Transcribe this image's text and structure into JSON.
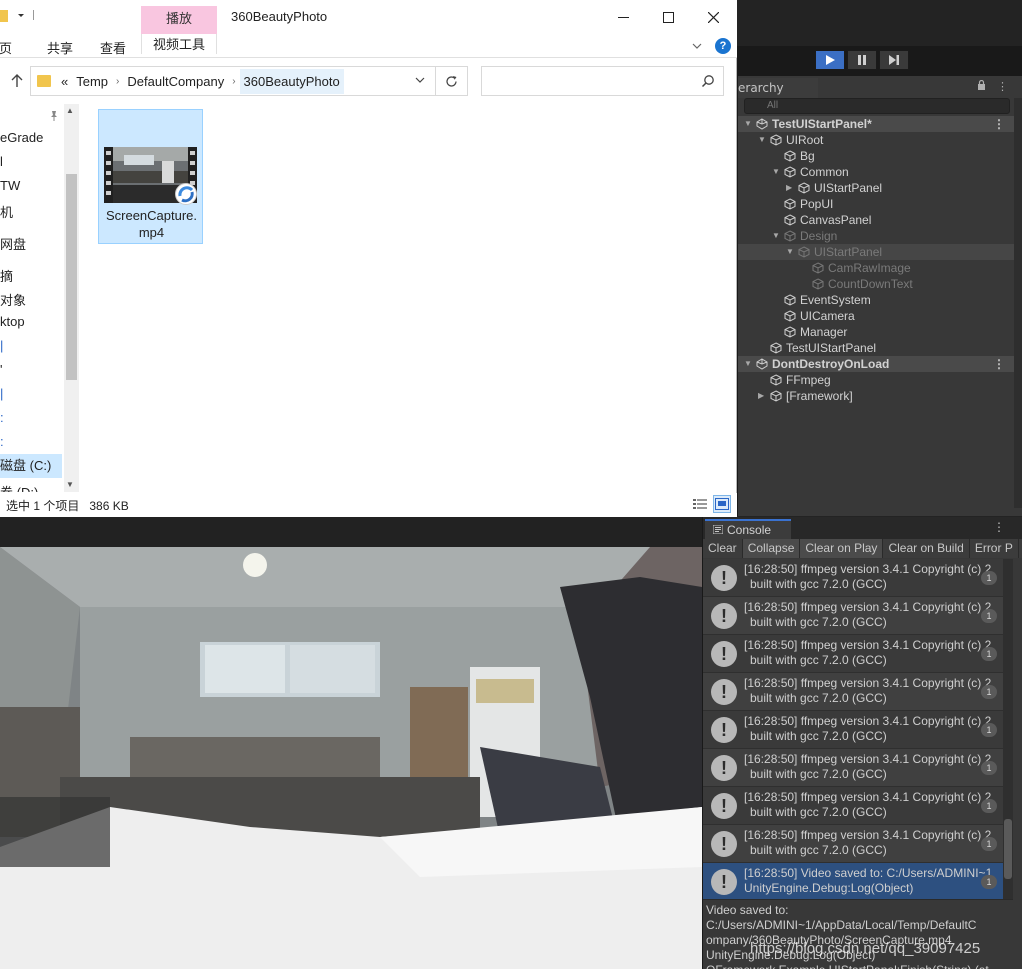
{
  "explorer": {
    "window_title": "360BeautyPhoto",
    "context_tab": "播放",
    "ribbon_tabs": {
      "home_partial": "主页",
      "share": "共享",
      "view": "查看",
      "video_tools": "视频工具"
    },
    "breadcrumb": {
      "overflow": "«",
      "items": [
        "Temp",
        "DefaultCompany",
        "360BeautyPhoto"
      ]
    },
    "search_placeholder": "",
    "nav_items": [
      "eGrade",
      "l",
      "TW",
      "机",
      "网盘",
      "摘",
      "对象",
      "ktop",
      "磁盘 (C:)",
      "卷 (D:)"
    ],
    "file": {
      "name": "ScreenCapture.mp4",
      "name_line1": "ScreenCapture.",
      "name_line2": "mp4"
    },
    "status": {
      "selected": "选中 1 个项目",
      "size": "386 KB"
    }
  },
  "unity": {
    "hierarchy": {
      "tab_label": "erarchy",
      "search_placeholder": "All",
      "rows": [
        {
          "label": "TestUIStartPanel*",
          "depth": 0,
          "arrow": "down",
          "kind": "scene",
          "menu": true
        },
        {
          "label": "UIRoot",
          "depth": 1,
          "arrow": "down",
          "kind": "obj"
        },
        {
          "label": "Bg",
          "depth": 2,
          "arrow": "",
          "kind": "obj"
        },
        {
          "label": "Common",
          "depth": 2,
          "arrow": "down",
          "kind": "obj"
        },
        {
          "label": "UIStartPanel",
          "depth": 3,
          "arrow": "right",
          "kind": "obj"
        },
        {
          "label": "PopUI",
          "depth": 2,
          "arrow": "",
          "kind": "obj"
        },
        {
          "label": "CanvasPanel",
          "depth": 2,
          "arrow": "",
          "kind": "obj"
        },
        {
          "label": "Design",
          "depth": 2,
          "arrow": "down",
          "kind": "dim"
        },
        {
          "label": "UIStartPanel",
          "depth": 3,
          "arrow": "down",
          "kind": "dimsel"
        },
        {
          "label": "CamRawImage",
          "depth": 4,
          "arrow": "",
          "kind": "dim"
        },
        {
          "label": "CountDownText",
          "depth": 4,
          "arrow": "",
          "kind": "dim"
        },
        {
          "label": "EventSystem",
          "depth": 2,
          "arrow": "",
          "kind": "obj"
        },
        {
          "label": "UICamera",
          "depth": 2,
          "arrow": "",
          "kind": "obj"
        },
        {
          "label": "Manager",
          "depth": 2,
          "arrow": "",
          "kind": "obj"
        },
        {
          "label": "TestUIStartPanel",
          "depth": 1,
          "arrow": "",
          "kind": "obj"
        },
        {
          "label": "DontDestroyOnLoad",
          "depth": 0,
          "arrow": "down",
          "kind": "scene2",
          "menu": true
        },
        {
          "label": "FFmpeg",
          "depth": 1,
          "arrow": "",
          "kind": "obj"
        },
        {
          "label": "[Framework]",
          "depth": 1,
          "arrow": "right",
          "kind": "obj"
        }
      ]
    },
    "console": {
      "tab_label": "Console",
      "toolbar": [
        "Clear",
        "Collapse",
        "Clear on Play",
        "Clear on Build",
        "Error P"
      ],
      "logs": [
        {
          "line1": "[16:28:50] ffmpeg version 3.4.1 Copyright (c) 2",
          "line2": "built with gcc 7.2.0 (GCC)",
          "count": "1"
        },
        {
          "line1": "[16:28:50] ffmpeg version 3.4.1 Copyright (c) 2",
          "line2": "built with gcc 7.2.0 (GCC)",
          "count": "1"
        },
        {
          "line1": "[16:28:50] ffmpeg version 3.4.1 Copyright (c) 2",
          "line2": "built with gcc 7.2.0 (GCC)",
          "count": "1"
        },
        {
          "line1": "[16:28:50] ffmpeg version 3.4.1 Copyright (c) 2",
          "line2": "built with gcc 7.2.0 (GCC)",
          "count": "1"
        },
        {
          "line1": "[16:28:50] ffmpeg version 3.4.1 Copyright (c) 2",
          "line2": "built with gcc 7.2.0 (GCC)",
          "count": "1"
        },
        {
          "line1": "[16:28:50] ffmpeg version 3.4.1 Copyright (c) 2",
          "line2": "built with gcc 7.2.0 (GCC)",
          "count": "1"
        },
        {
          "line1": "[16:28:50] ffmpeg version 3.4.1 Copyright (c) 2",
          "line2": "built with gcc 7.2.0 (GCC)",
          "count": "1"
        },
        {
          "line1": "[16:28:50] ffmpeg version 3.4.1 Copyright (c) 2",
          "line2": "built with gcc 7.2.0 (GCC)",
          "count": "1"
        },
        {
          "line1": "[16:28:50] Video saved to: C:/Users/ADMINI~1",
          "line2": "UnityEngine.Debug:Log(Object)",
          "count": "1"
        }
      ],
      "detail": [
        "Video saved to:",
        "C:/Users/ADMINI~1/AppData/Local/Temp/DefaultC",
        "ompany/360BeautyPhoto/ScreenCapture.mp4",
        "UnityEngine.Debug:Log(Object)",
        "QFramework.Example.UIStartPanel:Finish(String) (at"
      ]
    }
  },
  "watermark": "https://blog.csdn.net/qq_39097425",
  "colors": {
    "selection_blue": "#cce8ff",
    "unity_panel": "#383838",
    "unity_selected": "#2d5080",
    "context_tab_pink": "#f9c6e0",
    "play_active": "#3b6fc4"
  }
}
